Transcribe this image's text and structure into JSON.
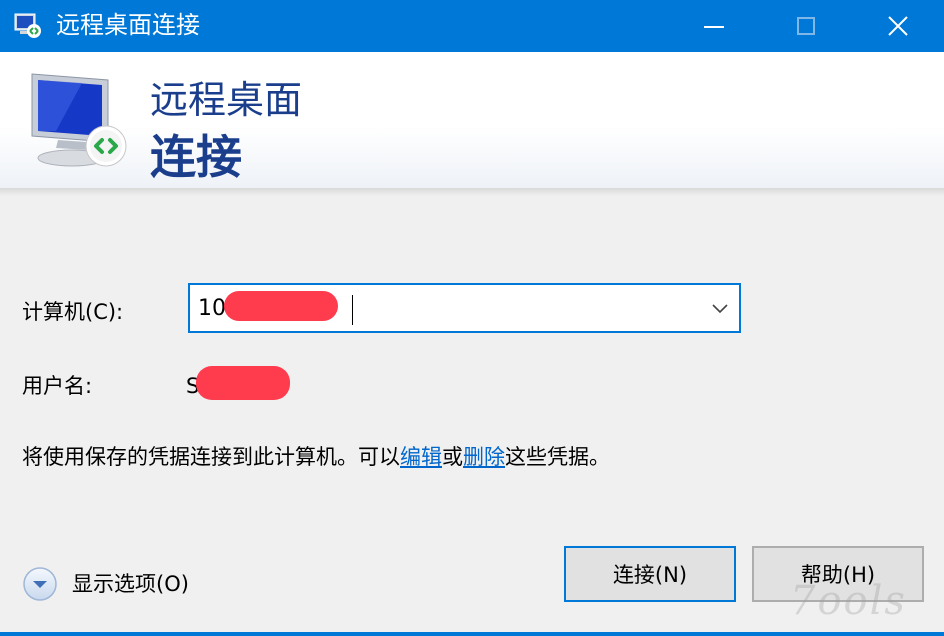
{
  "window": {
    "title": "远程桌面连接",
    "controls": {
      "minimize": "minimize",
      "maximize": "maximize",
      "close": "close"
    }
  },
  "banner": {
    "line1": "远程桌面",
    "line2": "连接"
  },
  "form": {
    "computer_label": "计算机(C):",
    "computer_value_visible": "10                     2",
    "username_label": "用户名:",
    "username_value_visible": "S"
  },
  "info": {
    "prefix": "将使用保存的凭据连接到此计算机。可以",
    "edit_link": "编辑",
    "middle": "或",
    "delete_link": "删除",
    "suffix": "这些凭据。"
  },
  "options": {
    "label": "显示选项(O)"
  },
  "buttons": {
    "connect": "连接(N)",
    "help": "帮助(H)"
  },
  "watermark": "7ools",
  "colors": {
    "titlebar": "#0078d7",
    "banner_text": "#1a3e8c",
    "link": "#0066cc",
    "redaction": "#ff3b4e"
  }
}
